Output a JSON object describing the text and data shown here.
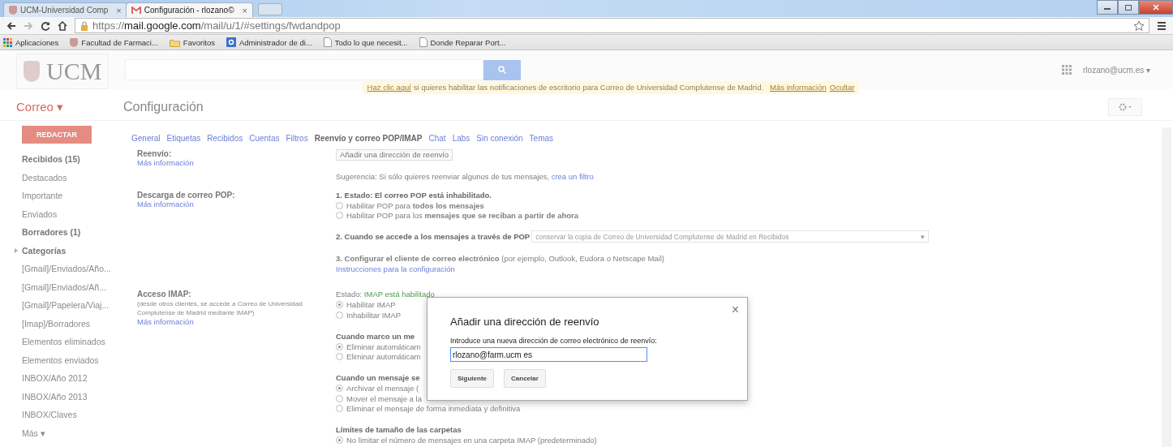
{
  "browser": {
    "tabs": [
      {
        "label": "UCM-Universidad Comp",
        "selected": false
      },
      {
        "label": "Configuración - rlozano©",
        "selected": true
      }
    ],
    "close_glyph": "×",
    "url": {
      "scheme": "https://",
      "host": "mail.google.com",
      "path": "/mail/u/1/#settings/fwdandpop"
    },
    "bookmarks": [
      {
        "label": "Aplicaciones"
      },
      {
        "label": "Facultad de Farmaci..."
      },
      {
        "label": "Favoritos"
      },
      {
        "label": "Administrador de di..."
      },
      {
        "label": "Todo lo que necesit..."
      },
      {
        "label": "Donde Reparar Port..."
      }
    ]
  },
  "header": {
    "logo": "UCM",
    "account": "rlozano@ucm.es ▾"
  },
  "notice": {
    "link": "Haz clic aquí",
    "text": " si quieres habilitar las notificaciones de escritorio para Correo de Universidad Complutense de Madrid.",
    "more": "Más información",
    "hide": "Ocultar"
  },
  "app_menu": "Correo ▾",
  "page_title": "Configuración",
  "compose": "REDACTAR",
  "sidebar": [
    {
      "kind": "item",
      "label": "Recibidos (15)",
      "bold": true
    },
    {
      "kind": "item",
      "label": "Destacados",
      "bold": false
    },
    {
      "kind": "item",
      "label": "Importante",
      "bold": false
    },
    {
      "kind": "item",
      "label": "Enviados",
      "bold": false
    },
    {
      "kind": "item",
      "label": "Borradores (1)",
      "bold": true
    },
    {
      "kind": "group",
      "label": "Categorías",
      "bold": true,
      "expanded": false
    },
    {
      "kind": "item",
      "label": "[Gmail]/Enviados/Año...",
      "bold": false
    },
    {
      "kind": "item",
      "label": "[Gmail]/Enviados/Añ...",
      "bold": false
    },
    {
      "kind": "item",
      "label": "[Gmail]/Papelera/Viaj...",
      "bold": false
    },
    {
      "kind": "item",
      "label": "[Imap]/Borradores",
      "bold": false
    },
    {
      "kind": "item",
      "label": "Elementos eliminados",
      "bold": false
    },
    {
      "kind": "item",
      "label": "Elementos enviados",
      "bold": false
    },
    {
      "kind": "item",
      "label": "INBOX/Año 2012",
      "bold": false
    },
    {
      "kind": "item",
      "label": "INBOX/Año 2013",
      "bold": false
    },
    {
      "kind": "item",
      "label": "INBOX/Claves",
      "bold": false
    },
    {
      "kind": "item",
      "label": "Más ▾",
      "bold": false
    }
  ],
  "settings_tabs": [
    {
      "label": "General",
      "selected": false
    },
    {
      "label": "Etiquetas",
      "selected": false
    },
    {
      "label": "Recibidos",
      "selected": false
    },
    {
      "label": "Cuentas",
      "selected": false
    },
    {
      "label": "Filtros",
      "selected": false
    },
    {
      "label": "Reenvío y correo POP/IMAP",
      "selected": true
    },
    {
      "label": "Chat",
      "selected": false
    },
    {
      "label": "Labs",
      "selected": false
    },
    {
      "label": "Sin conexión",
      "selected": false
    },
    {
      "label": "Temas",
      "selected": false
    }
  ],
  "sections": [
    {
      "label": "Reenvío:",
      "link": "Más información",
      "blocks": [
        {
          "kind": "button",
          "text": "Añadir una dirección de reenvío"
        },
        {
          "kind": "text",
          "text": "Sugerencia: Si sólo quieres reenviar algunos de tus mensajes, ",
          "link": "crea un filtro"
        }
      ]
    },
    {
      "label": "Descarga de correo POP:",
      "link": "Más información",
      "blocks": [
        {
          "kind": "heading",
          "text": "1. Estado: El correo POP está inhabilitado."
        },
        {
          "kind": "radio",
          "text": "Habilitar POP para **todos los mensajes**",
          "checked": false
        },
        {
          "kind": "radio",
          "text": "Habilitar POP para los **mensajes que se reciban a partir de ahora**",
          "checked": false
        },
        {
          "kind": "select",
          "text": "2. Cuando se accede a los mensajes a través de POP",
          "value": "conservar la copia de Correo de Universidad Complutense de Madrid en Recibidos",
          "caret": "▾"
        },
        {
          "kind": "text",
          "text": "**3. Configurar el cliente de correo electrónico** (por ejemplo, Outlook, Eudora o Netscape Mail)"
        },
        {
          "kind": "link",
          "text": "Instrucciones para la configuración"
        }
      ]
    },
    {
      "label": "Acceso IMAP:",
      "desc": "(desde otros clientes, se accede a Correo de Universidad Complutense de Madrid mediante IMAP)",
      "link": "Más información",
      "blocks": [
        {
          "kind": "status",
          "text": "Estado: ",
          "value": "IMAP está habilitado"
        },
        {
          "kind": "radio",
          "text": "Habilitar IMAP",
          "checked": true
        },
        {
          "kind": "radio",
          "text": "Inhabilitar IMAP",
          "checked": false
        },
        {
          "kind": "heading",
          "text": "Cuando marco un me"
        },
        {
          "kind": "radio",
          "text": "Eliminar automáticam",
          "checked": true
        },
        {
          "kind": "radio",
          "text": "Eliminar automáticam",
          "checked": false
        },
        {
          "kind": "heading",
          "text": "Cuando un mensaje se"
        },
        {
          "kind": "radio",
          "text": "Archivar el mensaje (",
          "checked": true
        },
        {
          "kind": "radio",
          "text": "Mover el mensaje a la",
          "checked": false
        },
        {
          "kind": "radio",
          "text": "Eliminar el mensaje de forma inmediata y definitiva",
          "checked": false
        },
        {
          "kind": "heading",
          "text": "Límites de tamaño de las carpetas"
        },
        {
          "kind": "radio",
          "text": "No limitar el número de mensajes en una carpeta IMAP (predeterminado)",
          "checked": true
        }
      ]
    }
  ],
  "dialog": {
    "title": "Añadir una dirección de reenvío",
    "close": "×",
    "label": "Introduce una nueva dirección de correo electrónico de reenvío:",
    "value": "rlozano@farm.ucm es",
    "buttons": [
      "Siguiente",
      "Cancelar"
    ]
  }
}
